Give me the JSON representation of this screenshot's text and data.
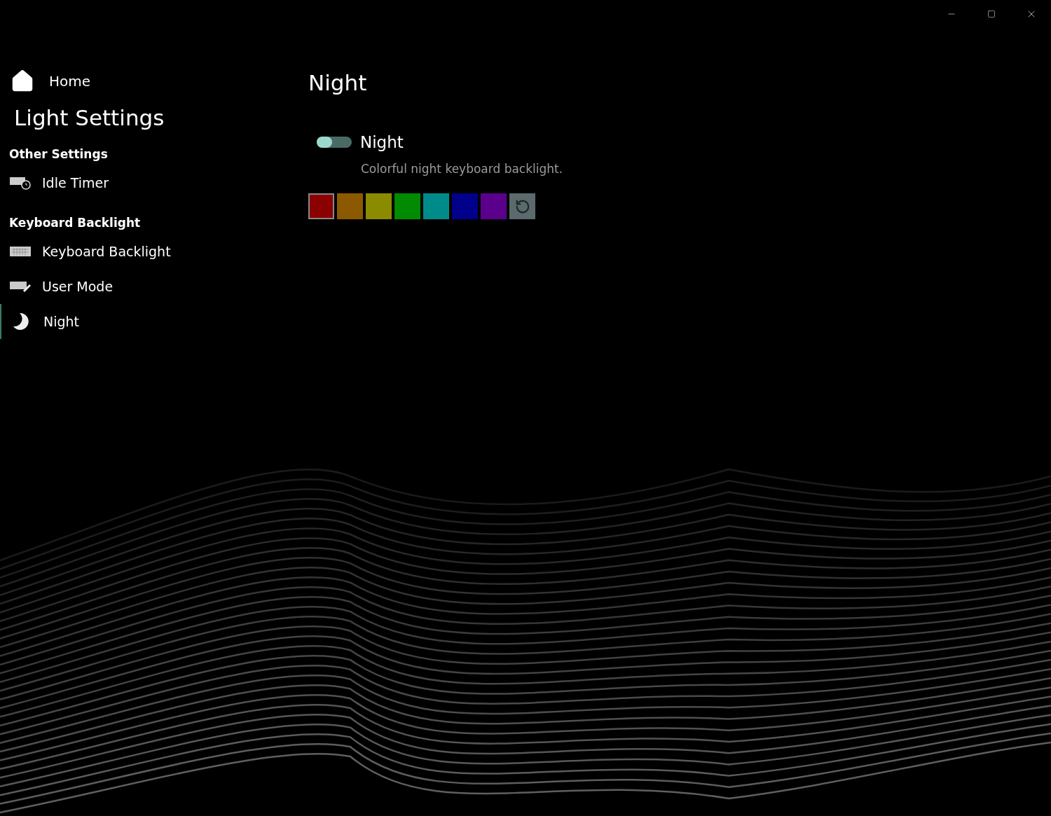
{
  "sidebar": {
    "home": "Home",
    "title": "Light Settings",
    "sections": [
      {
        "heading": "Other Settings",
        "items": [
          {
            "label": "Idle Timer",
            "kind": "timer",
            "selected": false
          }
        ]
      },
      {
        "heading": "Keyboard Backlight",
        "items": [
          {
            "label": "Keyboard Backlight",
            "kind": "keyboard",
            "selected": false
          },
          {
            "label": "User Mode",
            "kind": "edit",
            "selected": false
          },
          {
            "label": "Night",
            "kind": "moon",
            "selected": true
          }
        ]
      }
    ]
  },
  "page": {
    "title": "Night",
    "setting": {
      "label": "Night",
      "on": false,
      "description": "Colorful night keyboard backlight."
    },
    "swatches": [
      {
        "color": "#8b0000",
        "selected": true
      },
      {
        "color": "#8b5a00",
        "selected": false
      },
      {
        "color": "#8b8b00",
        "selected": false
      },
      {
        "color": "#008b00",
        "selected": false
      },
      {
        "color": "#008b8b",
        "selected": false
      },
      {
        "color": "#00008b",
        "selected": false
      },
      {
        "color": "#5a008b",
        "selected": false
      }
    ]
  }
}
